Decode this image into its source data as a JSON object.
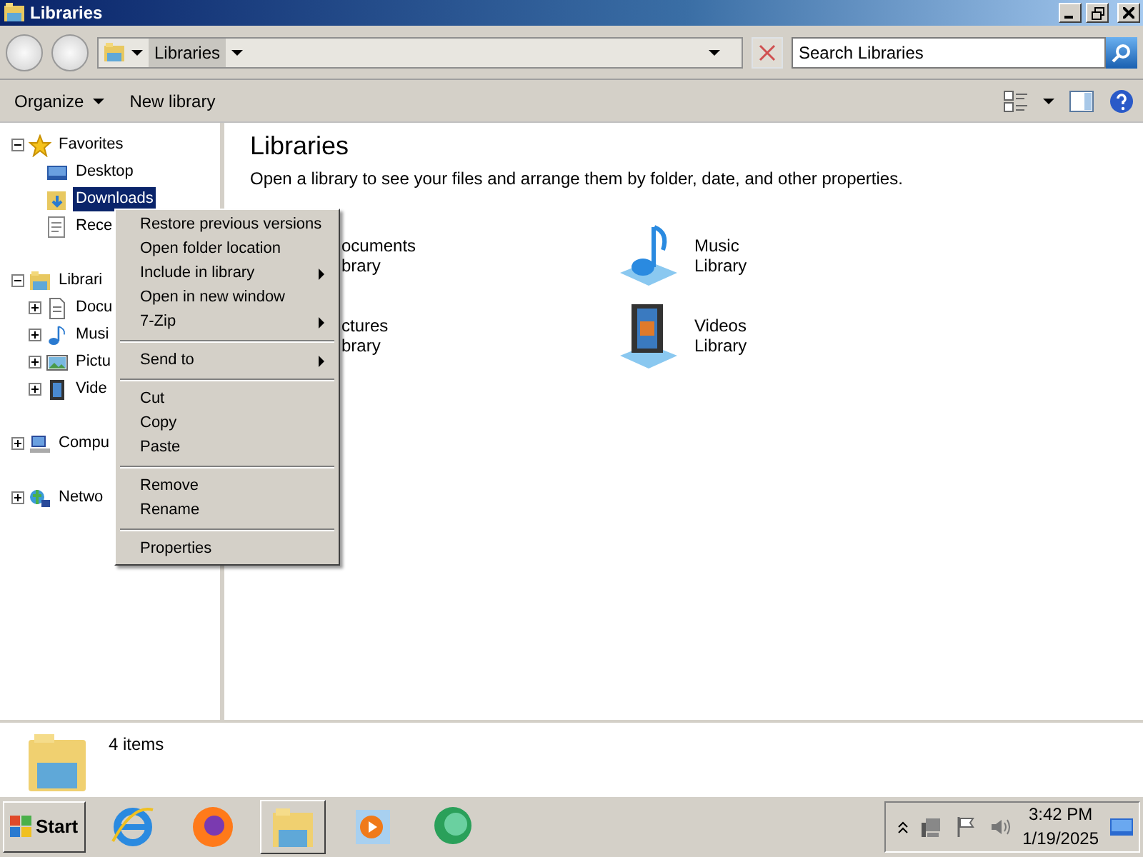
{
  "window": {
    "title": "Libraries"
  },
  "address_bar": {
    "breadcrumb": "Libraries",
    "search": {
      "placeholder": "Search Libraries"
    }
  },
  "toolbar": {
    "buttons": [
      {
        "label": "Organize",
        "dropdown": true
      },
      {
        "label": "New library",
        "dropdown": false
      }
    ]
  },
  "navigation": {
    "items": [
      {
        "label": "Favorites",
        "expanded": true,
        "selected": false,
        "children": [
          {
            "label": "Desktop",
            "selected": false
          },
          {
            "label": "Downloads",
            "selected": true
          },
          {
            "label": "Rece",
            "selected": false
          }
        ]
      },
      {
        "label": "Librari",
        "expanded": true,
        "selected": false,
        "children": [
          {
            "label": "Docu",
            "expanded": false,
            "selected": false
          },
          {
            "label": "Musi",
            "expanded": false,
            "selected": false
          },
          {
            "label": "Pictu",
            "expanded": false,
            "selected": false
          },
          {
            "label": "Vide",
            "expanded": false,
            "selected": false
          }
        ]
      },
      {
        "label": "Compu",
        "expanded": false,
        "selected": false
      },
      {
        "label": "Netwo",
        "expanded": false,
        "selected": false
      }
    ]
  },
  "content": {
    "heading": "Libraries",
    "description": "Open a library to see your files and arrange them by folder, date, and other properties.",
    "libraries": [
      {
        "name": "ocuments",
        "type": "brary"
      },
      {
        "name": "Music",
        "type": "Library"
      },
      {
        "name": "ctures",
        "type": "brary"
      },
      {
        "name": "Videos",
        "type": "Library"
      }
    ]
  },
  "context_menu": {
    "items": [
      {
        "kind": "item",
        "label": "Restore previous versions",
        "submenu": false
      },
      {
        "kind": "item",
        "label": "Open folder location",
        "submenu": false
      },
      {
        "kind": "item",
        "label": "Include in library",
        "submenu": true
      },
      {
        "kind": "item",
        "label": "Open in new window",
        "submenu": false
      },
      {
        "kind": "item",
        "label": "7-Zip",
        "submenu": true
      },
      {
        "kind": "separator"
      },
      {
        "kind": "item",
        "label": "Send to",
        "submenu": true
      },
      {
        "kind": "separator"
      },
      {
        "kind": "item",
        "label": "Cut",
        "submenu": false
      },
      {
        "kind": "item",
        "label": "Copy",
        "submenu": false
      },
      {
        "kind": "item",
        "label": "Paste",
        "submenu": false
      },
      {
        "kind": "separator"
      },
      {
        "kind": "item",
        "label": "Remove",
        "submenu": false
      },
      {
        "kind": "item",
        "label": "Rename",
        "submenu": false
      },
      {
        "kind": "separator"
      },
      {
        "kind": "item",
        "label": "Properties",
        "submenu": false
      }
    ]
  },
  "details_pane": {
    "count": "4 items"
  },
  "taskbar": {
    "start": "Start",
    "pinned": [
      {
        "selected": false
      },
      {
        "selected": false
      },
      {
        "selected": true
      },
      {
        "selected": false
      },
      {
        "selected": false
      }
    ],
    "clock": {
      "time": "3:42 PM",
      "date": "1/19/2025"
    }
  }
}
